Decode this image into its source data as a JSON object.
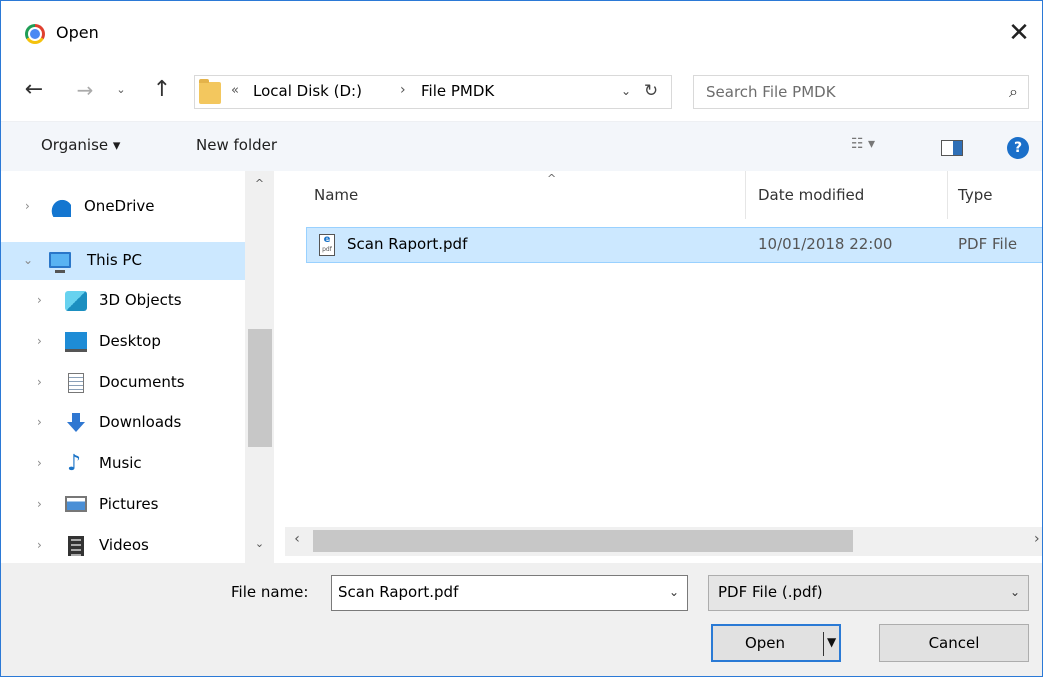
{
  "window": {
    "title": "Open",
    "close_glyph": "✕",
    "app_icon": "chrome-icon"
  },
  "nav": {
    "back": "←",
    "forward": "→",
    "recent": "⌄",
    "up": "↑"
  },
  "address": {
    "overflow": "«",
    "crumbs": [
      "Local Disk (D:)",
      "File PMDK"
    ],
    "separator": "›",
    "dropdown": "⌄",
    "refresh": "↻"
  },
  "search": {
    "placeholder": "Search File PMDK",
    "icon": "⌕"
  },
  "toolbar": {
    "organise_label": "Organise ▾",
    "new_folder_label": "New folder",
    "view_label": "☷ ▾",
    "help_label": "?"
  },
  "sidebar": {
    "items": [
      {
        "label": "OneDrive",
        "icon": "onedrive-icon"
      },
      {
        "label": "This PC",
        "icon": "pc-icon",
        "selected": true,
        "expanded": true
      },
      {
        "label": "3D Objects",
        "icon": "3d-objects-icon"
      },
      {
        "label": "Desktop",
        "icon": "desktop-icon"
      },
      {
        "label": "Documents",
        "icon": "documents-icon"
      },
      {
        "label": "Downloads",
        "icon": "downloads-icon"
      },
      {
        "label": "Music",
        "icon": "music-icon"
      },
      {
        "label": "Pictures",
        "icon": "pictures-icon"
      },
      {
        "label": "Videos",
        "icon": "videos-icon"
      }
    ],
    "chevron_collapsed": "›",
    "chevron_expanded": "⌄",
    "scroll_up": "^",
    "scroll_down": "⌄"
  },
  "files": {
    "sort_glyph": "^",
    "columns": [
      "Name",
      "Date modified",
      "Type"
    ],
    "rows": [
      {
        "name": "Scan Raport.pdf",
        "date": "10/01/2018 22:00",
        "type": "PDF File",
        "selected": true
      }
    ],
    "scroll_left": "‹",
    "scroll_right": "›"
  },
  "bottom": {
    "file_name_label": "File name:",
    "file_name_value": "Scan Raport.pdf",
    "file_type_value": "PDF File (.pdf)",
    "dropdown": "⌄",
    "open_label": "Open",
    "open_drop": "▼",
    "cancel_label": "Cancel"
  },
  "colors": {
    "accent": "#2a7ad5",
    "selection": "#cce8ff",
    "toolbar_bg": "#f3f6fa"
  }
}
